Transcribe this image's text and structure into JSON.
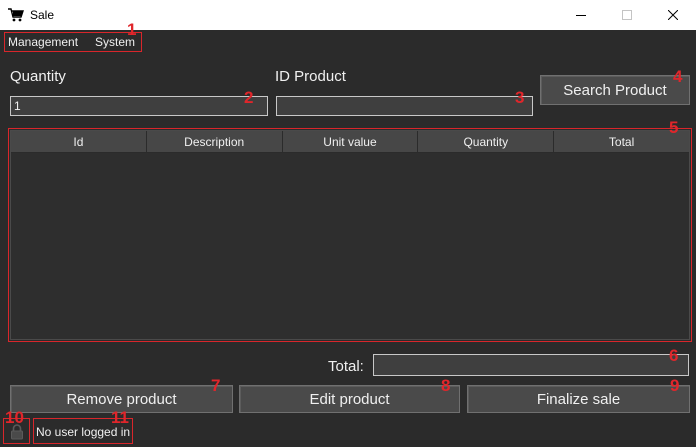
{
  "window": {
    "title": "Sale",
    "icon": "cart-icon"
  },
  "menu": {
    "items": [
      "Management",
      "System"
    ]
  },
  "form": {
    "quantity_label": "Quantity",
    "quantity_value": "1",
    "id_product_label": "ID Product",
    "id_product_value": "",
    "search_button": "Search Product"
  },
  "table": {
    "columns": [
      "Id",
      "Description",
      "Unit value",
      "Quantity",
      "Total"
    ],
    "rows": []
  },
  "totals": {
    "label": "Total:",
    "value": ""
  },
  "actions": {
    "remove": "Remove product",
    "edit": "Edit product",
    "finalize": "Finalize sale"
  },
  "status": {
    "icon": "lock-icon",
    "text": "No user logged in"
  },
  "markers": [
    "1",
    "2",
    "3",
    "4",
    "5",
    "6",
    "7",
    "8",
    "9",
    "10",
    "11"
  ],
  "colors": {
    "background": "#2b2b2b",
    "button": "#4a4a4a",
    "annotation": "#e0262b"
  }
}
